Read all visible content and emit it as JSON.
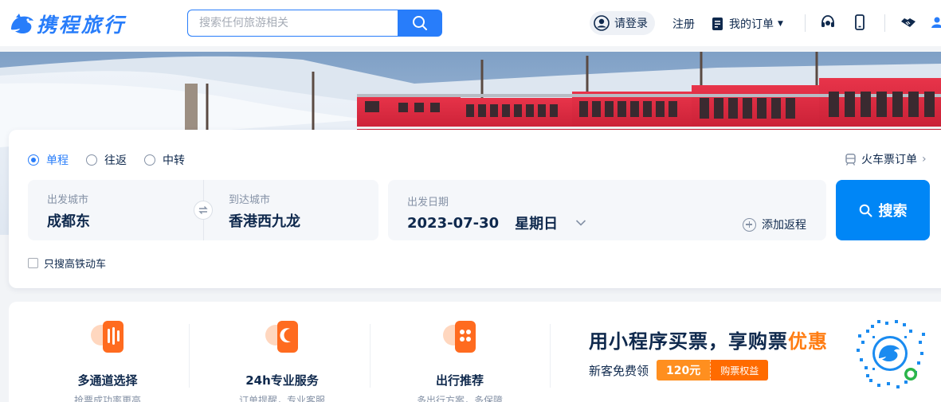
{
  "header": {
    "logo_text": "携程旅行",
    "search_placeholder": "搜索任何旅游相关",
    "login_label": "请登录",
    "register_label": "注册",
    "orders_label": "我的订单"
  },
  "booking": {
    "trip_types": [
      {
        "label": "单程",
        "selected": true
      },
      {
        "label": "往返",
        "selected": false
      },
      {
        "label": "中转",
        "selected": false
      }
    ],
    "ticket_order_label": "火车票订单",
    "from_label": "出发城市",
    "from_value": "成都东",
    "to_label": "到达城市",
    "to_value": "香港西九龙",
    "date_label": "出发日期",
    "date_value": "2023-07-30",
    "weekday": "星期日",
    "add_return_label": "添加返程",
    "search_label": "搜索",
    "hsr_only_label": "只搜高铁动车"
  },
  "features": [
    {
      "title": "多通道选择",
      "sub": "抢票成功率更高"
    },
    {
      "title": "24h专业服务",
      "sub": "订单提醒，专业客服"
    },
    {
      "title": "出行推荐",
      "sub": "多出行方案，多保障"
    }
  ],
  "promo": {
    "headline": "用小程序买票，享购票",
    "headline_highlight": "优惠",
    "subline": "新客免费领",
    "amount": "120元",
    "benefit": "购票权益"
  },
  "colors": {
    "brand": "#287dfa",
    "search_button": "#0086f6",
    "accent_orange": "#ff7d13",
    "text_primary": "#0f294d",
    "text_secondary": "#8592a6"
  }
}
